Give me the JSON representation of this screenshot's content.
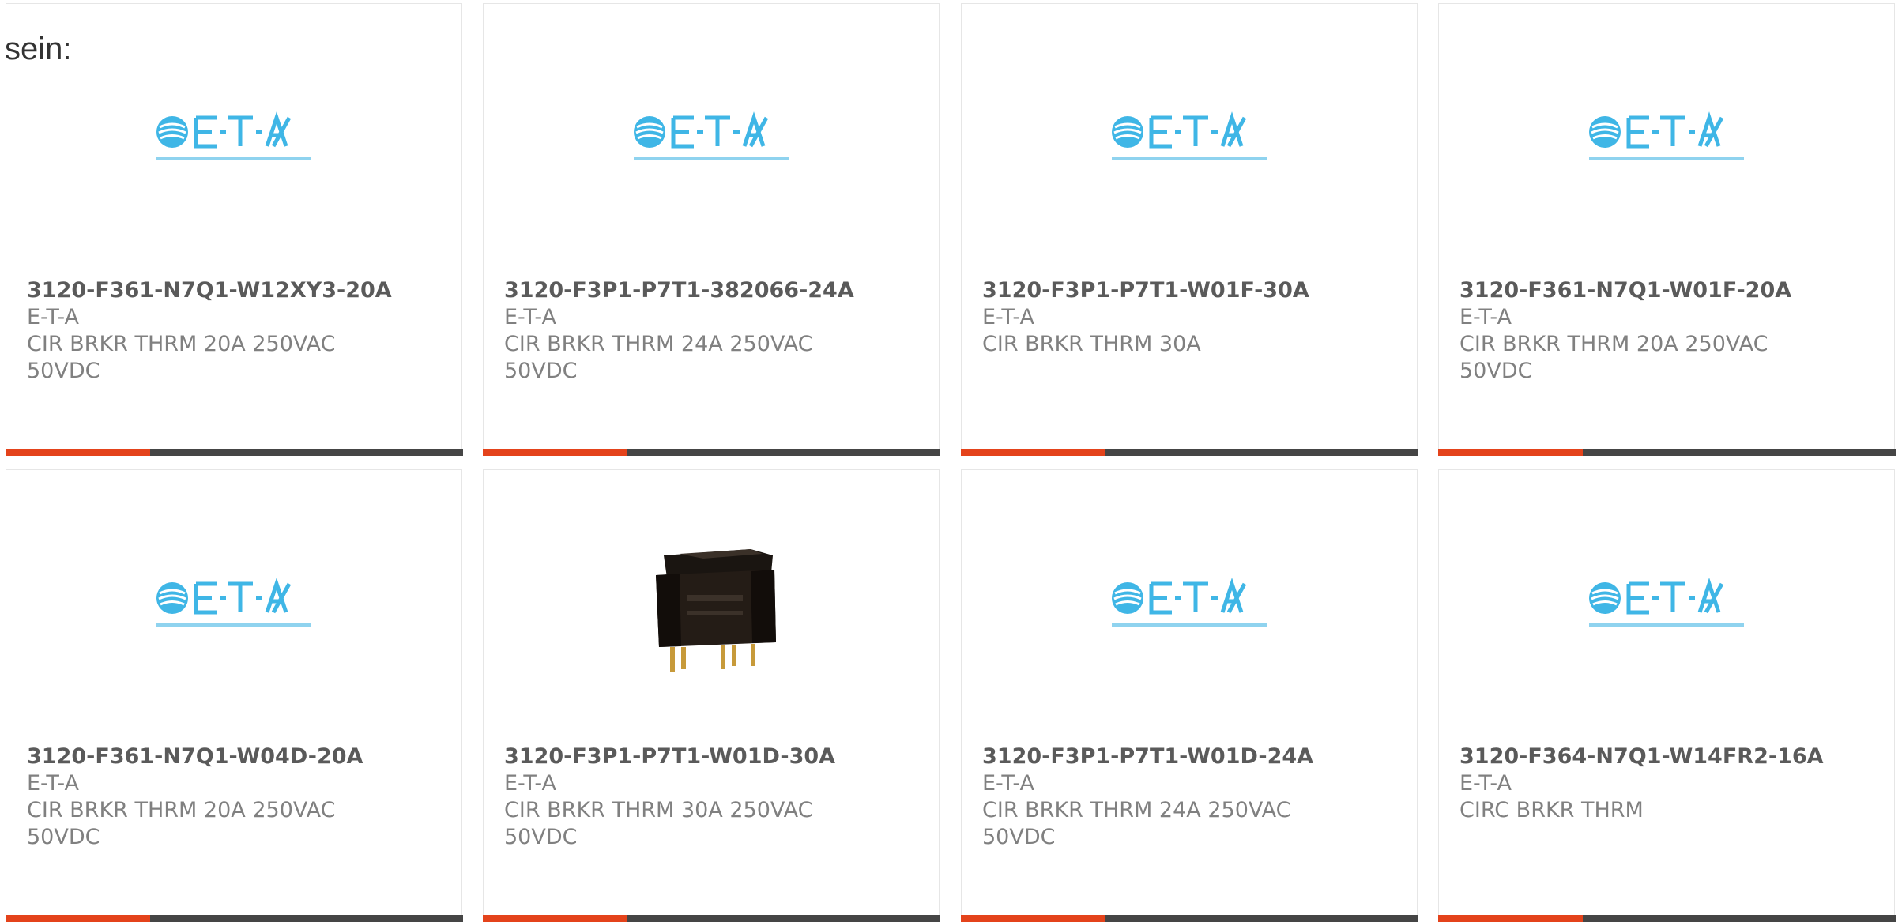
{
  "intro_text": "sein:",
  "colors": {
    "accent": "#e4431b",
    "bar": "#454545",
    "logo_blue": "#3fb6e6"
  },
  "products": [
    {
      "part_number": "3120-F361-N7Q1-W12XY3-20A",
      "manufacturer": "E-T-A",
      "description": "CIR BRKR THRM 20A 250VAC 50VDC",
      "image": "eta-logo"
    },
    {
      "part_number": "3120-F3P1-P7T1-382066-24A",
      "manufacturer": "E-T-A",
      "description": "CIR BRKR THRM 24A 250VAC 50VDC",
      "image": "eta-logo"
    },
    {
      "part_number": "3120-F3P1-P7T1-W01F-30A",
      "manufacturer": "E-T-A",
      "description": "CIR BRKR THRM 30A",
      "image": "eta-logo"
    },
    {
      "part_number": "3120-F361-N7Q1-W01F-20A",
      "manufacturer": "E-T-A",
      "description": "CIR BRKR THRM 20A 250VAC 50VDC",
      "image": "eta-logo"
    },
    {
      "part_number": "3120-F361-N7Q1-W04D-20A",
      "manufacturer": "E-T-A",
      "description": "CIR BRKR THRM 20A 250VAC 50VDC",
      "image": "eta-logo"
    },
    {
      "part_number": "3120-F3P1-P7T1-W01D-30A",
      "manufacturer": "E-T-A",
      "description": "CIR BRKR THRM 30A 250VAC 50VDC",
      "image": "rocker-switch-photo"
    },
    {
      "part_number": "3120-F3P1-P7T1-W01D-24A",
      "manufacturer": "E-T-A",
      "description": "CIR BRKR THRM 24A 250VAC 50VDC",
      "image": "eta-logo"
    },
    {
      "part_number": "3120-F364-N7Q1-W14FR2-16A",
      "manufacturer": "E-T-A",
      "description": "CIRC BRKR THRM",
      "image": "eta-logo"
    }
  ]
}
